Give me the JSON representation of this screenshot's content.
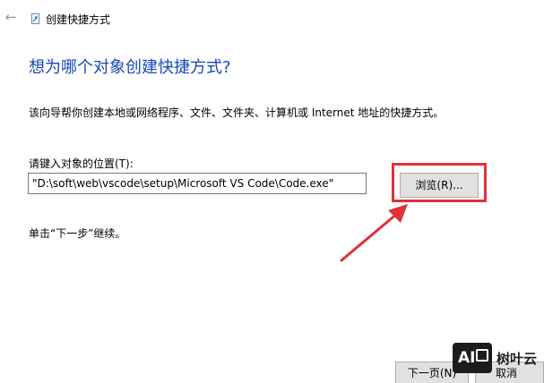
{
  "titlebar": {
    "back_icon": "back-arrow-icon",
    "app_icon": "shortcut-wizard-icon",
    "title": "创建快捷方式"
  },
  "main": {
    "heading": "想为哪个对象创建快捷方式?",
    "description": "该向导帮你创建本地或网络程序、文件、文件夹、计算机或 Internet 地址的快捷方式。",
    "location_label": "请键入对象的位置(T):",
    "location_value": "\"D:\\soft\\web\\vscode\\setup\\Microsoft VS Code\\Code.exe\"",
    "browse_label": "浏览(R)...",
    "hint": "单击“下一步”继续。"
  },
  "footer": {
    "next_label": "下一页(N)",
    "cancel_label": "取消"
  },
  "watermark": {
    "logo_text": "AI",
    "brand": "树叶云"
  },
  "colors": {
    "heading": "#1a47b8",
    "annotation": "#e0303a",
    "button_bg": "#e1e1e1"
  }
}
